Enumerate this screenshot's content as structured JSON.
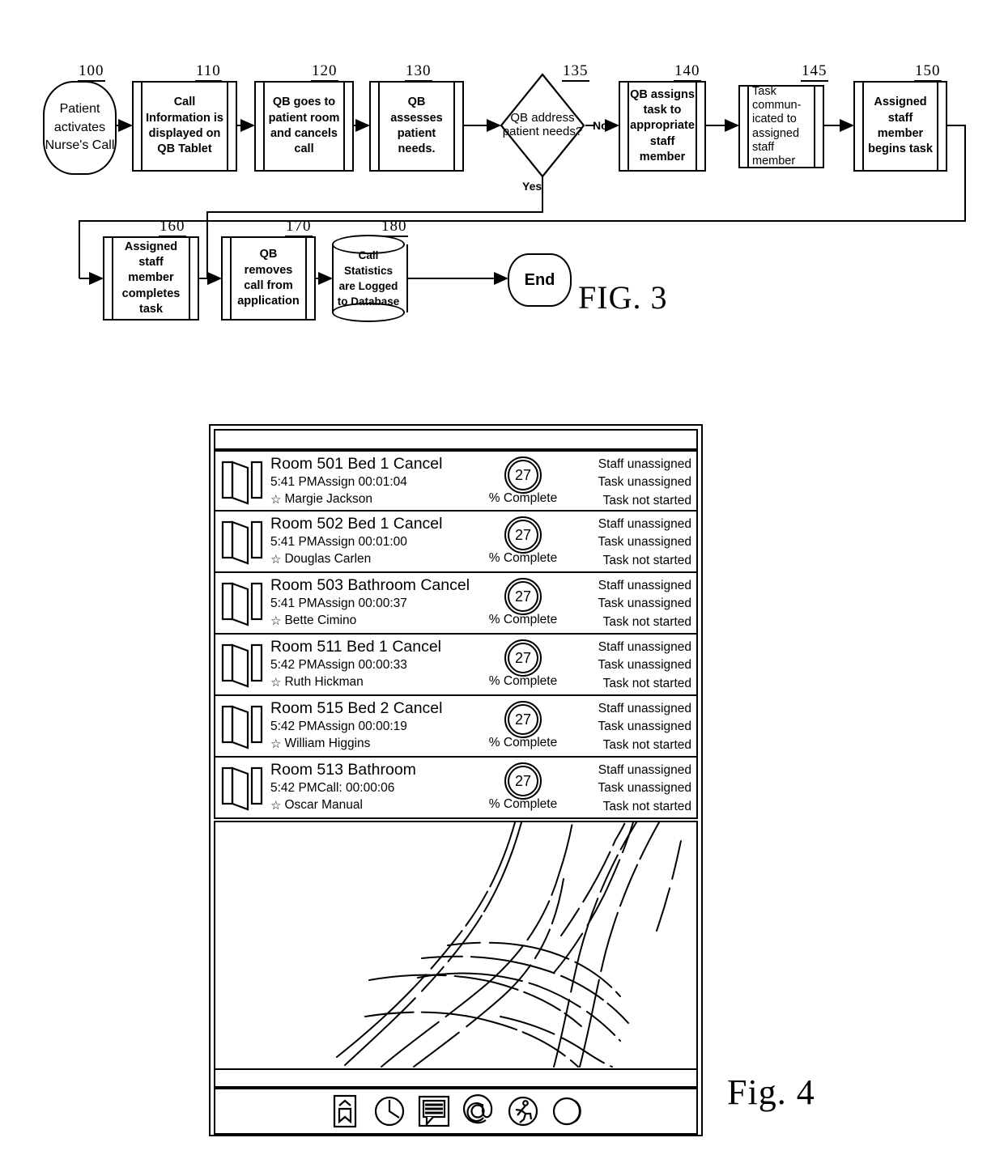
{
  "figure3": {
    "label": "FIG. 3",
    "nodes": [
      {
        "id": "100",
        "ref": "100",
        "shape": "terminator",
        "text": "Patient activates Nurse's Call"
      },
      {
        "id": "110",
        "ref": "110",
        "shape": "process",
        "text": "Call Information is displayed on QB Tablet"
      },
      {
        "id": "120",
        "ref": "120",
        "shape": "process",
        "text": "QB goes to patient room and cancels call"
      },
      {
        "id": "130",
        "ref": "130",
        "shape": "process",
        "text": "QB assesses patient needs."
      },
      {
        "id": "135",
        "ref": "135",
        "shape": "decision",
        "text": "QB address patient needs?"
      },
      {
        "id": "140",
        "ref": "140",
        "shape": "process",
        "text": "QB assigns task to appropriate staff member"
      },
      {
        "id": "145",
        "ref": "145",
        "shape": "process",
        "text": "Task commun- icated to assigned staff member"
      },
      {
        "id": "150",
        "ref": "150",
        "shape": "process",
        "text": "Assigned staff member begins task"
      },
      {
        "id": "160",
        "ref": "160",
        "shape": "process",
        "text": "Assigned staff member completes task"
      },
      {
        "id": "170",
        "ref": "170",
        "shape": "process",
        "text": "QB removes call from application"
      },
      {
        "id": "180",
        "ref": "180",
        "shape": "database",
        "text": "Call Statistics are Logged to Database"
      },
      {
        "id": "end",
        "ref": "",
        "shape": "terminator",
        "text": "End"
      }
    ],
    "edge_labels": {
      "yes": "Yes",
      "no": "No"
    }
  },
  "figure4": {
    "label": "Fig. 4",
    "header": {
      "title": ""
    },
    "columns": {
      "percent_label": "% Complete"
    },
    "rows": [
      {
        "icon": "door-icon",
        "title": "Room 501 Bed 1 Cancel",
        "subtitle": "5:41 PMAssign 00:01:04",
        "staff": "Margie Jackson",
        "percent": "27",
        "percent_label": "% Complete",
        "status": [
          "Staff unassigned",
          "Task unassigned",
          "Task not started"
        ]
      },
      {
        "icon": "door-icon",
        "title": "Room 502 Bed 1 Cancel",
        "subtitle": "5:41 PMAssign 00:01:00",
        "staff": "Douglas Carlen",
        "percent": "27",
        "percent_label": "% Complete",
        "status": [
          "Staff unassigned",
          "Task unassigned",
          "Task not started"
        ]
      },
      {
        "icon": "door-icon",
        "title": "Room 503 Bathroom Cancel",
        "subtitle": "5:41 PMAssign 00:00:37",
        "staff": "Bette Cimino",
        "percent": "27",
        "percent_label": "% Complete",
        "status": [
          "Staff unassigned",
          "Task unassigned",
          "Task not started"
        ]
      },
      {
        "icon": "door-icon",
        "title": "Room 511 Bed 1 Cancel",
        "subtitle": "5:42 PMAssign 00:00:33",
        "staff": "Ruth Hickman",
        "percent": "27",
        "percent_label": "% Complete",
        "status": [
          "Staff unassigned",
          "Task unassigned",
          "Task not started"
        ]
      },
      {
        "icon": "door-icon",
        "title": "Room 515 Bed 2 Cancel",
        "subtitle": "5:42 PMAssign 00:00:19",
        "staff": "William Higgins",
        "percent": "27",
        "percent_label": "% Complete",
        "status": [
          "Staff unassigned",
          "Task unassigned",
          "Task not started"
        ]
      },
      {
        "icon": "door-icon",
        "title": "Room 513 Bathroom",
        "subtitle": "5:42 PMCall: 00:00:06",
        "staff": "Oscar Manual",
        "percent": "27",
        "percent_label": "% Complete",
        "status": [
          "Staff unassigned",
          "Task unassigned",
          "Task not started"
        ]
      }
    ],
    "toolbar": [
      {
        "icon": "bookmark-icon",
        "label": ""
      },
      {
        "icon": "clock-icon",
        "label": ""
      },
      {
        "icon": "message-icon",
        "label": ""
      },
      {
        "icon": "at-sign-icon",
        "label": ""
      },
      {
        "icon": "running-person-icon",
        "label": ""
      },
      {
        "icon": "circle-icon",
        "label": ""
      }
    ]
  },
  "colors": {
    "ink": "#000000",
    "paper": "#ffffff"
  }
}
